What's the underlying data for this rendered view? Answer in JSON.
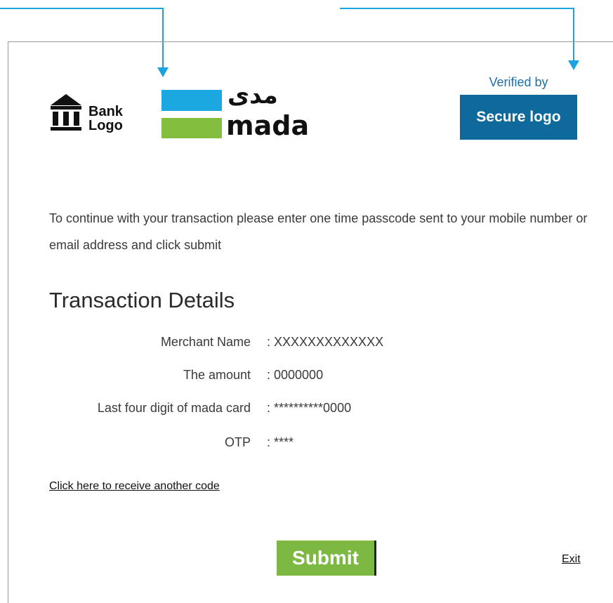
{
  "header": {
    "bank_logo_text_line1": "Bank",
    "bank_logo_text_line2": "Logo",
    "mada_arabic": "مدى",
    "mada_english": "mada",
    "verified_label": "Verified by",
    "secure_logo_text": "Secure logo"
  },
  "colors": {
    "accent_blue": "#1ba8e0",
    "accent_green": "#84be3e",
    "secure_logo_bg": "#0f6a9c",
    "submit_bg": "#7cb842"
  },
  "instructions": "To continue with your transaction please enter one time passcode sent to your mobile number or email address and click submit",
  "transaction": {
    "title": "Transaction Details",
    "rows": [
      {
        "label": "Merchant Name",
        "value": ": XXXXXXXXXXXXX"
      },
      {
        "label": "The amount",
        "value": ": 0000000"
      },
      {
        "label": "Last four digit of mada card",
        "value": ": **********0000"
      },
      {
        "label": "OTP",
        "value": ": ****"
      }
    ]
  },
  "actions": {
    "resend_link": "Click here to receive another code",
    "submit_label": "Submit",
    "exit_label": "Exit"
  }
}
